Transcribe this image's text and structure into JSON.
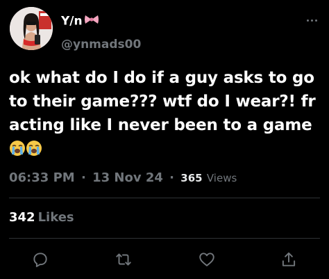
{
  "author": {
    "name": "Y/n",
    "handle": "@ynmads00"
  },
  "tweet": {
    "text": "ok what do I do if a guy asks to go to their game??? wtf do I wear?! fr acting like I never been to a game",
    "emojis": [
      "loudly-crying-face",
      "loudly-crying-face"
    ]
  },
  "meta": {
    "time": "06:33 PM",
    "separator": "·",
    "date": "13 Nov 24",
    "views_count": "365",
    "views_label": "Views"
  },
  "engagement": {
    "likes_count": "342",
    "likes_label": "Likes"
  },
  "actions": {
    "icons": [
      "reply-icon",
      "retweet-icon",
      "like-icon",
      "share-icon"
    ]
  },
  "colors": {
    "background": "#000000",
    "text": "#ffffff",
    "secondary": "#71767b",
    "divider": "#2f3336",
    "bow": "#f4a6c0"
  }
}
